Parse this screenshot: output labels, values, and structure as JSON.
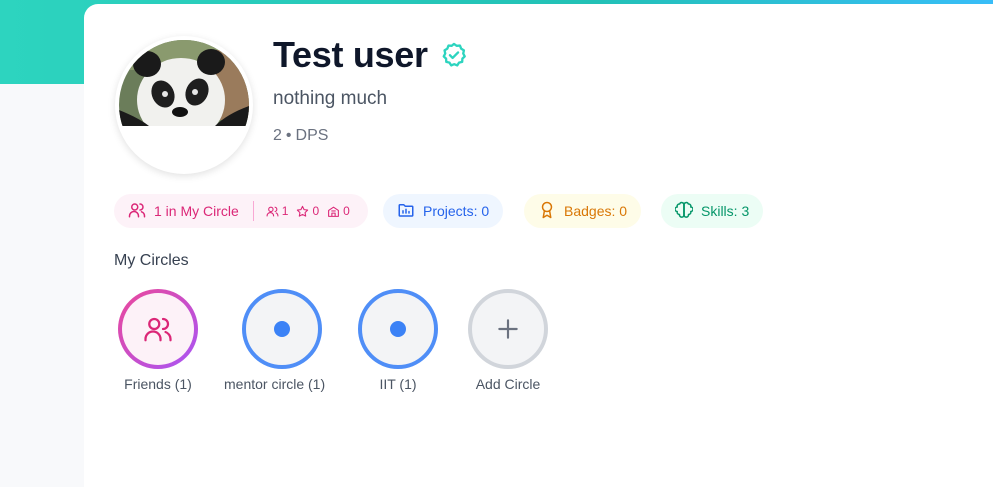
{
  "profile": {
    "name": "Test user",
    "tagline": "nothing much",
    "grade": "2",
    "separator": "•",
    "school": "DPS",
    "avatar_icon": "panda-photo",
    "verified_icon": "verified-badge-icon",
    "verified_color": "#2dd4bf"
  },
  "stats": {
    "circle": {
      "label": "1 in My Circle",
      "people": "1",
      "stars": "0",
      "buildings": "0",
      "color": "#db2777"
    },
    "projects": {
      "label": "Projects: 0",
      "color": "#2563eb"
    },
    "badges": {
      "label": "Badges: 0",
      "color": "#d97706"
    },
    "skills": {
      "label": "Skills: 3",
      "color": "#059669"
    }
  },
  "circles": {
    "title": "My Circles",
    "items": [
      {
        "label": "Friends (1)",
        "icon": "users-icon"
      },
      {
        "label": "mentor circle (1)",
        "icon": "dot"
      },
      {
        "label": "IIT (1)",
        "icon": "dot"
      },
      {
        "label": "Add Circle",
        "icon": "plus-icon"
      }
    ]
  }
}
